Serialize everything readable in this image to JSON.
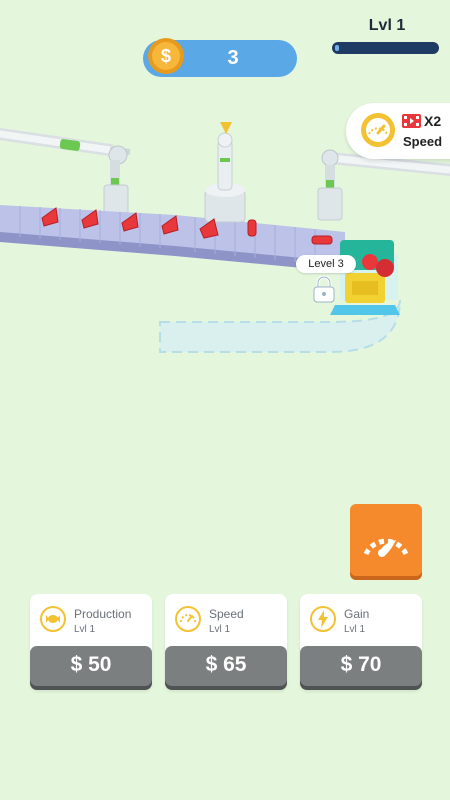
{
  "hud": {
    "coins": "3",
    "level_label": "Lvl 1",
    "level_progress": 0.03
  },
  "speed_boost": {
    "multiplier": "X2",
    "label": "Speed"
  },
  "scene": {
    "machine_level": "Level 3"
  },
  "upgrades": [
    {
      "name": "Production",
      "level": "Lvl 1",
      "price": "$ 50",
      "icon": "candy-icon"
    },
    {
      "name": "Speed",
      "level": "Lvl 1",
      "price": "$ 65",
      "icon": "speedometer-icon"
    },
    {
      "name": "Gain",
      "level": "Lvl 1",
      "price": "$ 70",
      "icon": "lightning-icon"
    }
  ],
  "colors": {
    "background": "#e4f7dc",
    "coin_pill": "#5aa9e6",
    "accent_orange": "#f58a2c",
    "price_button": "#7b7f7f",
    "icon_yellow": "#f2c232"
  }
}
